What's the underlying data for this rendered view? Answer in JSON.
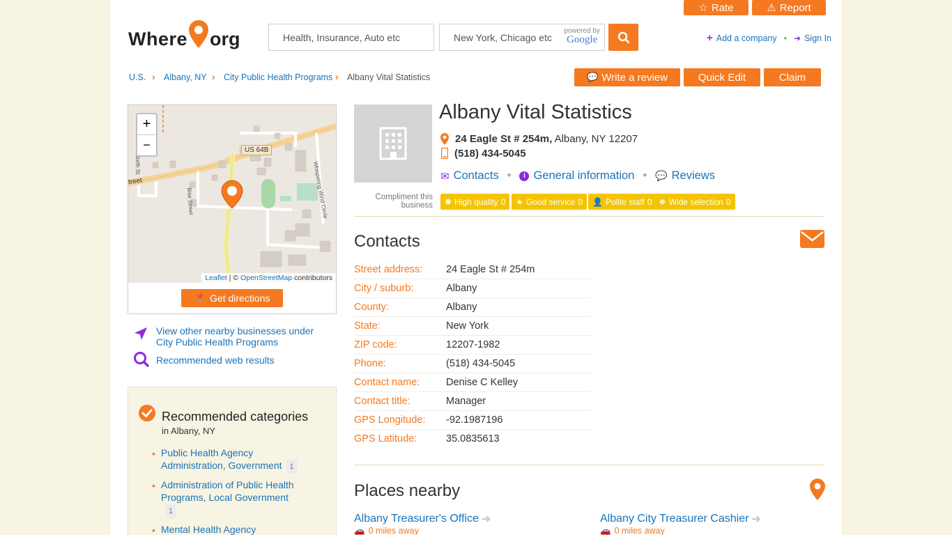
{
  "header": {
    "logo_left": "Where",
    "logo_right": "org",
    "rate_label": "Rate",
    "report_label": "Report",
    "search_placeholder": "Health, Insurance, Auto etc",
    "location_placeholder": "New York, Chicago etc",
    "powered_by": "powered by",
    "google": "Google",
    "add_company": "Add a company",
    "sign_in": "Sign In"
  },
  "breadcrumb": [
    "U.S.",
    "Albany, NY",
    "City Public Health Programs",
    "Albany Vital Statistics"
  ],
  "actions": {
    "write_review": "Write a review",
    "quick_edit": "Quick Edit",
    "claim": "Claim"
  },
  "map": {
    "zoom_in": "+",
    "zoom_out": "−",
    "road_label": "US 64B",
    "street_label_1": "treet",
    "street_label_2": "Bise Street",
    "street_label_3": "Whispering Wind Circle",
    "street_label_4": "North St",
    "attribution_leaflet": "Leaflet",
    "attribution_sep": " | © ",
    "attribution_osm": "OpenStreetMap",
    "attribution_contrib": " contributors",
    "directions": "Get directions"
  },
  "sidebar": {
    "nearby_link": "View other nearby businesses under City Public Health Programs",
    "recommended_web": "Recommended web results",
    "rec_title": "Recommended categories",
    "rec_sub": "in Albany, NY",
    "categories": [
      {
        "name": "Public Health Agency Administration, Government",
        "count": "1"
      },
      {
        "name": "Administration of Public Health Programs, Local Government",
        "count": "1"
      },
      {
        "name": "Mental Health Agency",
        "count": ""
      }
    ]
  },
  "business": {
    "name": "Albany Vital Statistics",
    "address_bold": "24 Eagle St # 254m,",
    "address_rest": " Albany, NY 12207",
    "phone": "(518) 434-5045",
    "tabs": [
      "Contacts",
      "General information",
      "Reviews"
    ],
    "compliment_label": "Compliment this business",
    "compliments": [
      {
        "label": "High quality",
        "count": "0"
      },
      {
        "label": "Good service",
        "count": "0"
      },
      {
        "label": "Polite staff",
        "count": "0"
      },
      {
        "label": "Wide selection",
        "count": "0"
      }
    ]
  },
  "contacts": {
    "title": "Contacts",
    "rows": [
      {
        "label": "Street address:",
        "value": "24 Eagle St # 254m"
      },
      {
        "label": "City / suburb:",
        "value": "Albany"
      },
      {
        "label": "County:",
        "value": "Albany"
      },
      {
        "label": "State:",
        "value": "New York"
      },
      {
        "label": "ZIP code:",
        "value": "12207-1982"
      },
      {
        "label": "Phone:",
        "value": "(518) 434-5045"
      },
      {
        "label": "Contact name:",
        "value": "Denise C Kelley"
      },
      {
        "label": "Contact title:",
        "value": "Manager"
      },
      {
        "label": "GPS Longitude:",
        "value": "-92.1987196"
      },
      {
        "label": "GPS Latitude:",
        "value": "35.0835613"
      }
    ]
  },
  "places": {
    "title": "Places nearby",
    "items": [
      {
        "name": "Albany Treasurer's Office",
        "distance": "0 miles away"
      },
      {
        "name": "Albany City Treasurer Cashier",
        "distance": "0 miles away"
      }
    ]
  },
  "colors": {
    "accent": "#f47920",
    "link": "#1a73b8",
    "tag": "#f5c400",
    "purple": "#8a2be2"
  }
}
